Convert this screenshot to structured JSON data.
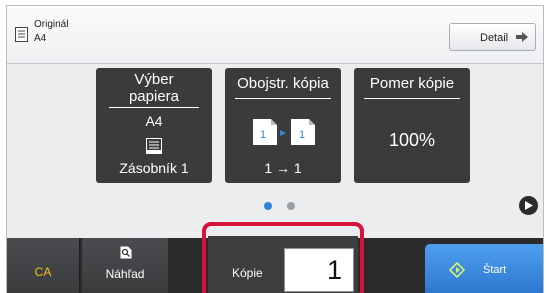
{
  "original": {
    "label": "Originál",
    "size": "A4"
  },
  "detail": {
    "label": "Detail"
  },
  "tiles": {
    "paper": {
      "title": "Výber papiera",
      "size": "A4",
      "tray": "Zásobník 1"
    },
    "duplex": {
      "title": "Obojstr. kópia",
      "value": "1 → 1"
    },
    "ratio": {
      "title": "Pomer kópie",
      "value": "100%"
    }
  },
  "pager": {
    "pages": 2,
    "active": 1
  },
  "bottom": {
    "ca_label": "CA",
    "preview_label": "Náhľad",
    "copies_label": "Kópie",
    "copies_value": "1",
    "start_label": "Štart"
  },
  "colors": {
    "ca_text": "#f1c21b",
    "highlight": "#d6123f",
    "start": "#3b8ee6",
    "page_dot_active": "#2f86dd"
  },
  "icons": [
    "original-document-icon",
    "arrow-right-icon",
    "paper-tray-icon",
    "duplex-copy-icon",
    "next-page-icon",
    "preview-magnifier-icon",
    "start-diamond-icon"
  ]
}
